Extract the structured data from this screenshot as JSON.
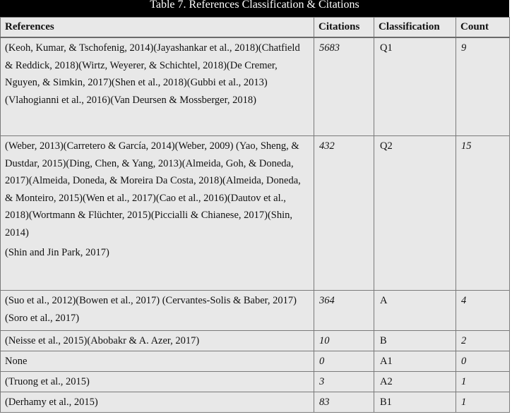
{
  "table": {
    "caption": "Table 7. References Classification & Citations",
    "headers": {
      "references": "References",
      "citations": "Citations",
      "classification": "Classification",
      "count": "Count"
    },
    "rows": [
      {
        "references": "(Keoh, Kumar, & Tschofenig, 2014)(Jayashankar et al., 2018)(Chatfield & Reddick, 2018)(Wirtz, Weyerer, & Schichtel, 2018)(De Cremer, Nguyen, & Simkin, 2017)(Shen et al., 2018)(Gubbi et al., 2013)(Vlahogianni et al., 2016)(Van Deursen & Mossberger, 2018)",
        "references_extra": "",
        "citations": "5683",
        "classification": "Q1",
        "count": "9"
      },
      {
        "references": "(Weber, 2013)(Carretero & García, 2014)(Weber, 2009) (Yao, Sheng, & Dustdar, 2015)(Ding, Chen, & Yang, 2013)(Almeida, Goh, & Doneda, 2017)(Almeida, Doneda, & Moreira Da Costa, 2018)(Almeida, Doneda, & Monteiro, 2015)(Wen et al., 2017)(Cao et al., 2016)(Dautov et al., 2018)(Wortmann & Flüchter, 2015)(Piccialli & Chianese, 2017)(Shin, 2014)",
        "references_extra": "(Shin and Jin Park, 2017)",
        "citations": "432",
        "classification": "Q2",
        "count": "15"
      },
      {
        "references": "(Suo et al., 2012)(Bowen et al., 2017) (Cervantes-Solis & Baber, 2017)(Soro et al., 2017)",
        "references_extra": "",
        "citations": "364",
        "classification": "A",
        "count": "4"
      },
      {
        "references": "(Neisse et al., 2015)(Abobakr & A. Azer, 2017)",
        "references_extra": "",
        "citations": "10",
        "classification": "B",
        "count": "2"
      },
      {
        "references": "None",
        "references_extra": "",
        "citations": "0",
        "classification": "A1",
        "count": "0"
      },
      {
        "references": "(Truong et al., 2015)",
        "references_extra": "",
        "citations": "3",
        "classification": "A2",
        "count": "1"
      },
      {
        "references": "(Derhamy et al., 2015)",
        "references_extra": "",
        "citations": "83",
        "classification": "B1",
        "count": "1"
      }
    ]
  }
}
